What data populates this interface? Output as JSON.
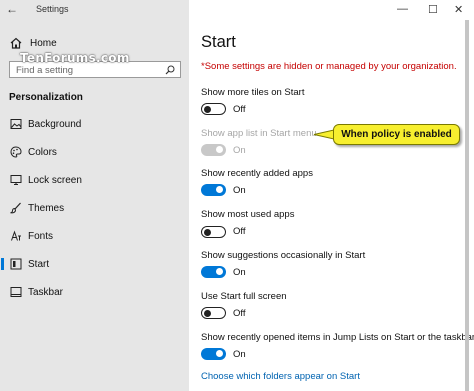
{
  "window": {
    "app_title": "Settings",
    "controls": {
      "minimize": "—",
      "maximize": "☐",
      "close": "✕"
    }
  },
  "sidebar": {
    "home_label": "Home",
    "watermark": "TenForums.com",
    "search_placeholder": "Find a setting",
    "section_title": "Personalization",
    "items": [
      {
        "label": "Background",
        "icon": "image-icon"
      },
      {
        "label": "Colors",
        "icon": "palette-icon"
      },
      {
        "label": "Lock screen",
        "icon": "monitor-icon"
      },
      {
        "label": "Themes",
        "icon": "brush-icon"
      },
      {
        "label": "Fonts",
        "icon": "font-icon"
      },
      {
        "label": "Start",
        "icon": "start-icon",
        "selected": true
      },
      {
        "label": "Taskbar",
        "icon": "taskbar-icon"
      }
    ]
  },
  "main": {
    "title": "Start",
    "warning": "*Some settings are hidden or managed by your organization.",
    "settings": [
      {
        "label": "Show more tiles on Start",
        "state": "Off",
        "on": false,
        "disabled": false
      },
      {
        "label": "Show app list in Start menu",
        "state": "On",
        "on": true,
        "disabled": true
      },
      {
        "label": "Show recently added apps",
        "state": "On",
        "on": true,
        "disabled": false
      },
      {
        "label": "Show most used apps",
        "state": "Off",
        "on": false,
        "disabled": false
      },
      {
        "label": "Show suggestions occasionally in Start",
        "state": "On",
        "on": true,
        "disabled": false
      },
      {
        "label": "Use Start full screen",
        "state": "Off",
        "on": false,
        "disabled": false
      },
      {
        "label": "Show recently opened items in Jump Lists on Start or the taskbar",
        "state": "On",
        "on": true,
        "disabled": false
      }
    ],
    "link": "Choose which folders appear on Start",
    "callout": "When policy is enabled"
  },
  "colors": {
    "accent": "#0078d7",
    "warning": "#c50000",
    "callout": "#f7ef2f"
  }
}
